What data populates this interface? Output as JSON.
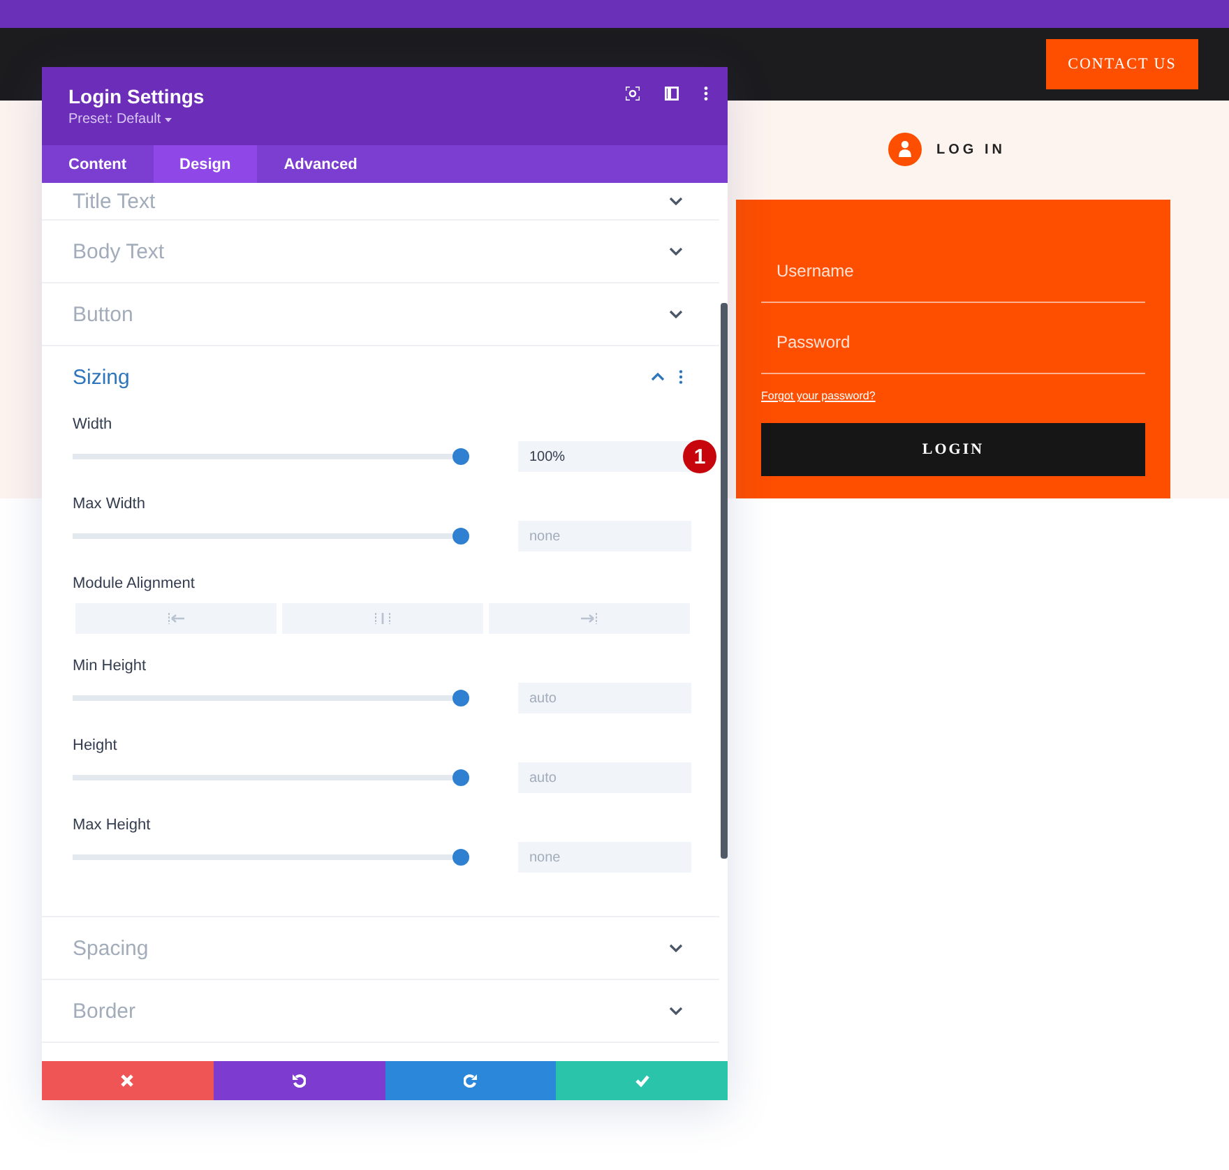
{
  "site": {
    "contact_button": "CONTACT US",
    "login_heading": "LOG IN",
    "form": {
      "username": {
        "placeholder": "Username"
      },
      "password": {
        "placeholder": "Password"
      },
      "forgot_link": "Forgot your password?",
      "login_button": "LOGIN"
    }
  },
  "panel": {
    "title": "Login Settings",
    "preset": "Preset: Default",
    "tabs": [
      {
        "label": "Content",
        "selected": false
      },
      {
        "label": "Design",
        "selected": true
      },
      {
        "label": "Advanced",
        "selected": false
      }
    ],
    "sections": [
      {
        "title": "Title Text",
        "expanded": false
      },
      {
        "title": "Body Text",
        "expanded": false
      },
      {
        "title": "Button",
        "expanded": false
      },
      {
        "title": "Sizing",
        "expanded": true,
        "fields": [
          {
            "kind": "slider",
            "label": "Width",
            "level": 0.98,
            "value": "100%",
            "badge": "1"
          },
          {
            "kind": "slider",
            "label": "Max Width",
            "level": 0.98,
            "placeholder": "none"
          },
          {
            "kind": "alignment",
            "label": "Module Alignment",
            "options": [
              {
                "kind": "left",
                "selected": false
              },
              {
                "kind": "center",
                "selected": false
              },
              {
                "kind": "right",
                "selected": false
              }
            ]
          },
          {
            "kind": "slider",
            "label": "Min Height",
            "level": 0.98,
            "placeholder": "auto"
          },
          {
            "kind": "slider",
            "label": "Height",
            "level": 0.98,
            "placeholder": "auto"
          },
          {
            "kind": "slider",
            "label": "Max Height",
            "level": 0.98,
            "placeholder": "none"
          }
        ]
      },
      {
        "title": "Spacing",
        "expanded": false
      },
      {
        "title": "Border",
        "expanded": false
      }
    ],
    "footer_buttons": [
      {
        "kind": "discard"
      },
      {
        "kind": "undo"
      },
      {
        "kind": "redo"
      },
      {
        "kind": "save"
      }
    ]
  }
}
